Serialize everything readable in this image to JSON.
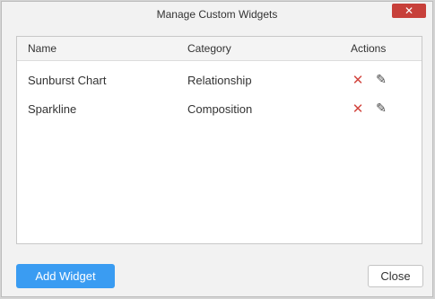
{
  "dialog": {
    "title": "Manage Custom Widgets",
    "close_icon": "close-icon"
  },
  "grid": {
    "columns": [
      "Name",
      "Category",
      "Actions"
    ],
    "rows": [
      {
        "name": "Sunburst Chart",
        "category": "Relationship"
      },
      {
        "name": "Sparkline",
        "category": "Composition"
      }
    ],
    "action_icons": [
      "delete-icon",
      "edit-icon"
    ],
    "delete_color": "#d2463f"
  },
  "footer": {
    "add_label": "Add Widget",
    "close_label": "Close",
    "accent": "#3a9cf2"
  }
}
